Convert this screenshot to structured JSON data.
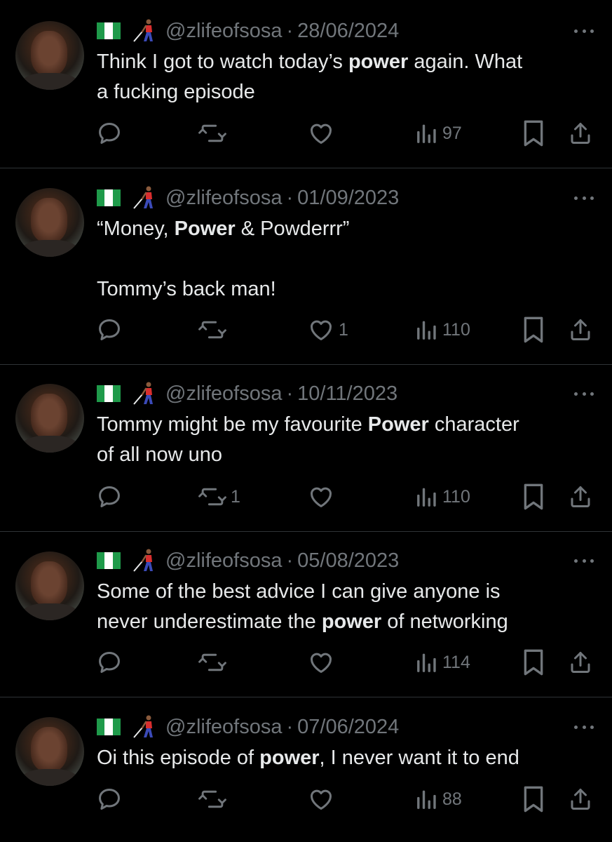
{
  "theme": {
    "background": "#000000",
    "text": "#e7e9ea",
    "muted": "#71767b",
    "divider": "#2f3336"
  },
  "tweets": [
    {
      "handle": "@zlifeofsosa",
      "separator": "·",
      "date": "28/06/2024",
      "emoji": [
        "nigeria-flag",
        "person-with-white-cane"
      ],
      "text": [
        {
          "t": "Think I got to watch today’s "
        },
        {
          "b": "power"
        },
        {
          "t": " again. What"
        },
        {
          "br": true
        },
        {
          "t": "a fucking episode"
        }
      ],
      "reply_count": "",
      "retweet_count": "",
      "like_count": "",
      "views": "97"
    },
    {
      "handle": "@zlifeofsosa",
      "separator": "·",
      "date": "01/09/2023",
      "emoji": [
        "nigeria-flag",
        "person-with-white-cane"
      ],
      "text": [
        {
          "t": "“Money, "
        },
        {
          "b": "Power"
        },
        {
          "t": " & Powderrr”"
        },
        {
          "br": true
        },
        {
          "br": true
        },
        {
          "t": "Tommy’s back man!"
        }
      ],
      "reply_count": "",
      "retweet_count": "",
      "like_count": "1",
      "views": "110"
    },
    {
      "handle": "@zlifeofsosa",
      "separator": "·",
      "date": "10/11/2023",
      "emoji": [
        "nigeria-flag",
        "person-with-white-cane"
      ],
      "text": [
        {
          "t": "Tommy might be my favourite "
        },
        {
          "b": "Power"
        },
        {
          "t": " character"
        },
        {
          "br": true
        },
        {
          "t": "of all now uno"
        }
      ],
      "reply_count": "",
      "retweet_count": "1",
      "like_count": "",
      "views": "110"
    },
    {
      "handle": "@zlifeofsosa",
      "separator": "·",
      "date": "05/08/2023",
      "emoji": [
        "nigeria-flag",
        "person-with-white-cane"
      ],
      "text": [
        {
          "t": "Some of the best advice I can give anyone is"
        },
        {
          "br": true
        },
        {
          "t": "never underestimate the "
        },
        {
          "b": "power"
        },
        {
          "t": " of networking"
        }
      ],
      "reply_count": "",
      "retweet_count": "",
      "like_count": "",
      "views": "114"
    },
    {
      "handle": "@zlifeofsosa",
      "separator": "·",
      "date": "07/06/2024",
      "emoji": [
        "nigeria-flag",
        "person-with-white-cane"
      ],
      "text": [
        {
          "t": "Oi this episode of "
        },
        {
          "b": "power"
        },
        {
          "t": ", I never want it to end"
        }
      ],
      "reply_count": "",
      "retweet_count": "",
      "like_count": "",
      "views": "88"
    }
  ]
}
